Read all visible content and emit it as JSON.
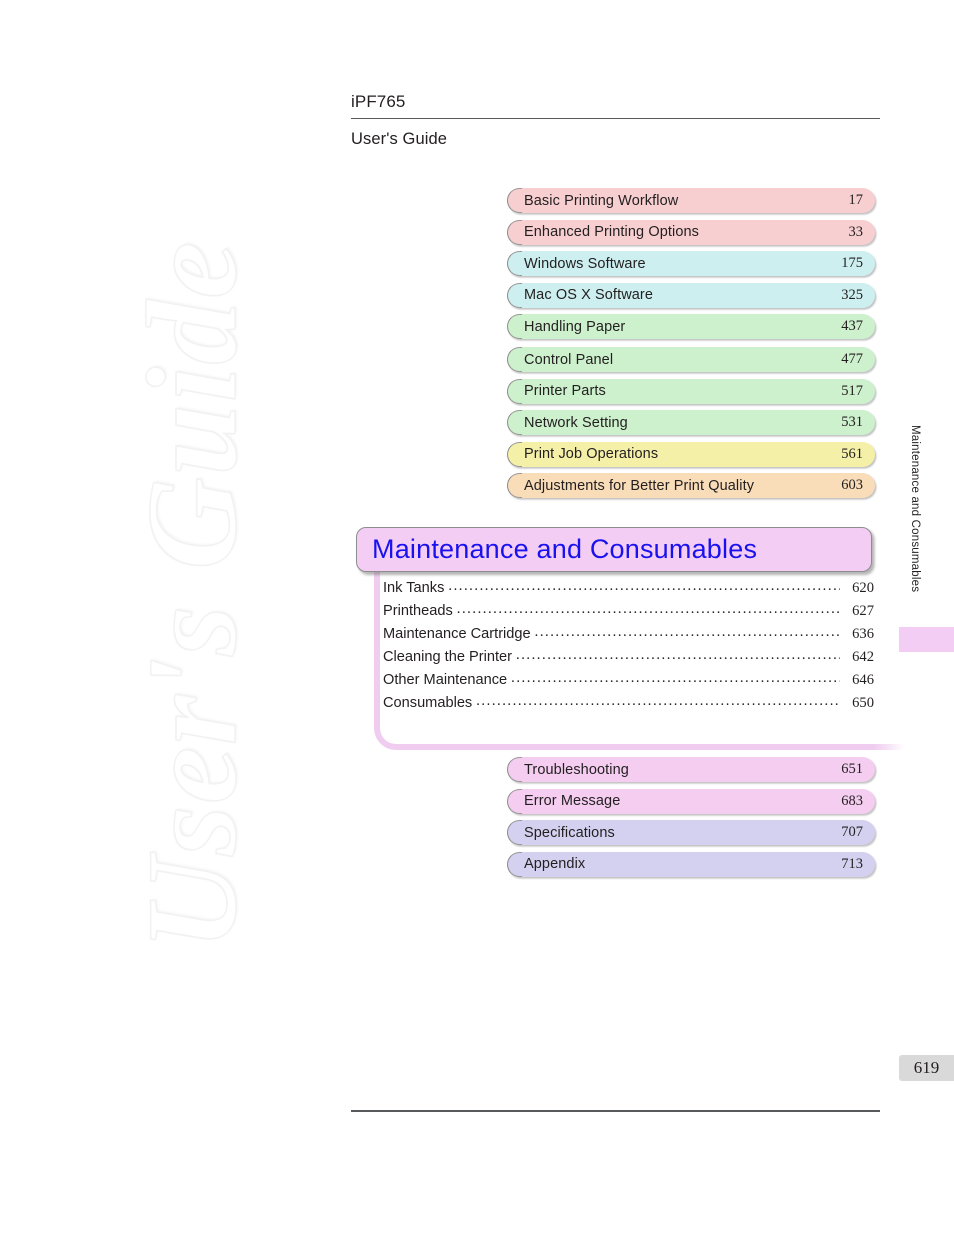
{
  "header": {
    "model": "iPF765",
    "guide_title": "User's Guide"
  },
  "watermark": {
    "text": "User's Guide"
  },
  "chapters_top": [
    {
      "label": "Basic Printing Workflow",
      "page": "17",
      "color": "#f7cfd0"
    },
    {
      "label": "Enhanced Printing Options",
      "page": "33",
      "color": "#f7cfd0"
    },
    {
      "label": "Windows Software",
      "page": "175",
      "color": "#cdeff0"
    },
    {
      "label": "Mac OS X Software",
      "page": "325",
      "color": "#cdeff0"
    },
    {
      "label": "Handling Paper",
      "page": "437",
      "color": "#cdf0cd"
    }
  ],
  "chapters_mid": [
    {
      "label": "Control Panel",
      "page": "477",
      "color": "#cdf0cd"
    },
    {
      "label": "Printer Parts",
      "page": "517",
      "color": "#cdf0cd"
    },
    {
      "label": "Network Setting",
      "page": "531",
      "color": "#cdf0cd"
    },
    {
      "label": "Print Job Operations",
      "page": "561",
      "color": "#f5f0a8"
    },
    {
      "label": "Adjustments for Better Print Quality",
      "page": "603",
      "color": "#f9dcb8"
    }
  ],
  "current_chapter": {
    "title": "Maintenance and Consumables",
    "title_color": "#1a12ee",
    "bar_color": "#f4cdf5",
    "entries": [
      {
        "name": "Ink Tanks",
        "page": "620"
      },
      {
        "name": "Printheads",
        "page": "627"
      },
      {
        "name": "Maintenance Cartridge",
        "page": "636"
      },
      {
        "name": "Cleaning the Printer",
        "page": "642"
      },
      {
        "name": "Other Maintenance",
        "page": "646"
      },
      {
        "name": "Consumables",
        "page": "650"
      }
    ]
  },
  "chapters_bottom": [
    {
      "label": "Troubleshooting",
      "page": "651",
      "color": "#f4cdf0"
    },
    {
      "label": "Error Message",
      "page": "683",
      "color": "#f4cdf0"
    },
    {
      "label": "Specifications",
      "page": "707",
      "color": "#d4d1f0"
    },
    {
      "label": "Appendix",
      "page": "713",
      "color": "#d4d1f0"
    }
  ],
  "side_tab": {
    "label": "Maintenance and Consumables"
  },
  "footer": {
    "page_number": "619"
  }
}
